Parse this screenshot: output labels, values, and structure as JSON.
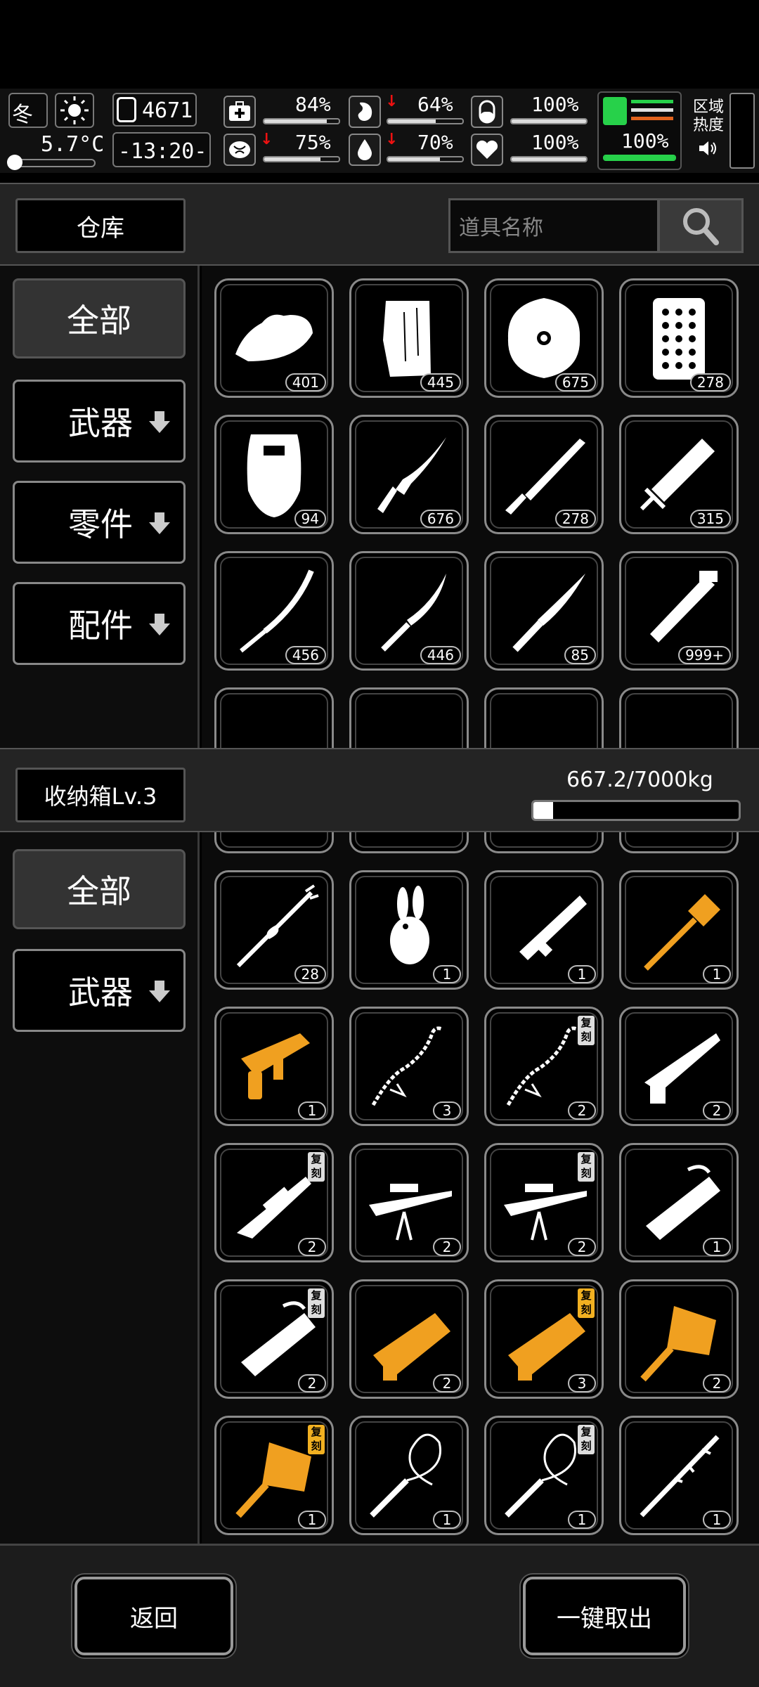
{
  "status": {
    "season": "冬",
    "temperature": "5.7°C",
    "day": "4671",
    "time": "-13:20-",
    "stats": [
      {
        "name": "health",
        "value": "84%",
        "fill": 0.84,
        "down": false
      },
      {
        "name": "hunger",
        "value": "64%",
        "fill": 0.64,
        "down": true
      },
      {
        "name": "shield",
        "value": "100%",
        "fill": 1.0,
        "down": false
      },
      {
        "name": "mood",
        "value": "75%",
        "fill": 0.75,
        "down": true
      },
      {
        "name": "thirst",
        "value": "70%",
        "fill": 0.7,
        "down": true
      },
      {
        "name": "heart",
        "value": "100%",
        "fill": 1.0,
        "down": false
      }
    ],
    "stamina": {
      "value": "100%",
      "fill": 1.0
    },
    "zone_heat": "区域\n热度",
    "zone_label_1": "区域",
    "zone_label_2": "热度"
  },
  "warehouse": {
    "title": "仓库",
    "search_placeholder": "道具名称",
    "categories": [
      {
        "label": "全部"
      },
      {
        "label": "武器"
      },
      {
        "label": "零件"
      },
      {
        "label": "配件"
      }
    ],
    "items": [
      {
        "icon": "iron-lid-icon",
        "qty": "401"
      },
      {
        "icon": "wood-plank-icon",
        "qty": "445"
      },
      {
        "icon": "round-shield-icon",
        "qty": "675"
      },
      {
        "icon": "riot-panel-icon",
        "qty": "278"
      },
      {
        "icon": "riot-shield-icon",
        "qty": "94"
      },
      {
        "icon": "kukri-icon",
        "qty": "676"
      },
      {
        "icon": "machete-icon",
        "qty": "278"
      },
      {
        "icon": "broadsword-icon",
        "qty": "315"
      },
      {
        "icon": "katana-icon",
        "qty": "456"
      },
      {
        "icon": "curved-blade-icon",
        "qty": "446"
      },
      {
        "icon": "knife-icon",
        "qty": "85"
      },
      {
        "icon": "pipe-wrench-icon",
        "qty": "999+"
      }
    ]
  },
  "storage": {
    "title": "收纳箱Lv.3",
    "weight": "667.2/7000kg",
    "weight_fraction": 0.095,
    "categories": [
      {
        "label": "全部"
      },
      {
        "label": "武器"
      }
    ],
    "items": [
      {
        "icon": "thorn-spear-icon",
        "qty": "28",
        "color": "#ffffff",
        "copy": false
      },
      {
        "icon": "rabbit-plush-icon",
        "qty": "1",
        "color": "#ffffff",
        "copy": false
      },
      {
        "icon": "rocket-launcher-icon",
        "qty": "1",
        "color": "#ffffff",
        "copy": false
      },
      {
        "icon": "gold-hammer-icon",
        "qty": "1",
        "color": "#f0a020",
        "copy": false
      },
      {
        "icon": "gold-rabbit-gun-icon",
        "qty": "1",
        "color": "#f0a020",
        "copy": false
      },
      {
        "icon": "chain-whip-icon",
        "qty": "3",
        "color": "#ffffff",
        "copy": false
      },
      {
        "icon": "chain-whip-icon",
        "qty": "2",
        "color": "#ffffff",
        "copy": true
      },
      {
        "icon": "dragon-rifle-icon",
        "qty": "2",
        "color": "#ffffff",
        "copy": false
      },
      {
        "icon": "dragon-sniper-icon",
        "qty": "2",
        "color": "#ffffff",
        "copy": true
      },
      {
        "icon": "bipod-sniper-icon",
        "qty": "2",
        "color": "#ffffff",
        "copy": false
      },
      {
        "icon": "bipod-sniper-icon",
        "qty": "2",
        "color": "#ffffff",
        "copy": true
      },
      {
        "icon": "dragon-cannon-icon",
        "qty": "1",
        "color": "#ffffff",
        "copy": false
      },
      {
        "icon": "dragon-cannon-icon",
        "qty": "2",
        "color": "#ffffff",
        "copy": true
      },
      {
        "icon": "gold-cannon-icon",
        "qty": "2",
        "color": "#f0a020",
        "copy": false
      },
      {
        "icon": "gold-cannon-icon",
        "qty": "3",
        "color": "#f0a020",
        "copy": true
      },
      {
        "icon": "gold-mace-icon",
        "qty": "2",
        "color": "#f0a020",
        "copy": false
      },
      {
        "icon": "gold-mace-icon",
        "qty": "1",
        "color": "#f0a020",
        "copy": true
      },
      {
        "icon": "whip-icon",
        "qty": "1",
        "color": "#ffffff",
        "copy": false
      },
      {
        "icon": "whip-icon",
        "qty": "1",
        "color": "#ffffff",
        "copy": true
      },
      {
        "icon": "thorn-staff-icon",
        "qty": "1",
        "color": "#ffffff",
        "copy": false
      }
    ],
    "copy_label": "复刻"
  },
  "buttons": {
    "back": "返回",
    "take_all": "一键取出"
  }
}
